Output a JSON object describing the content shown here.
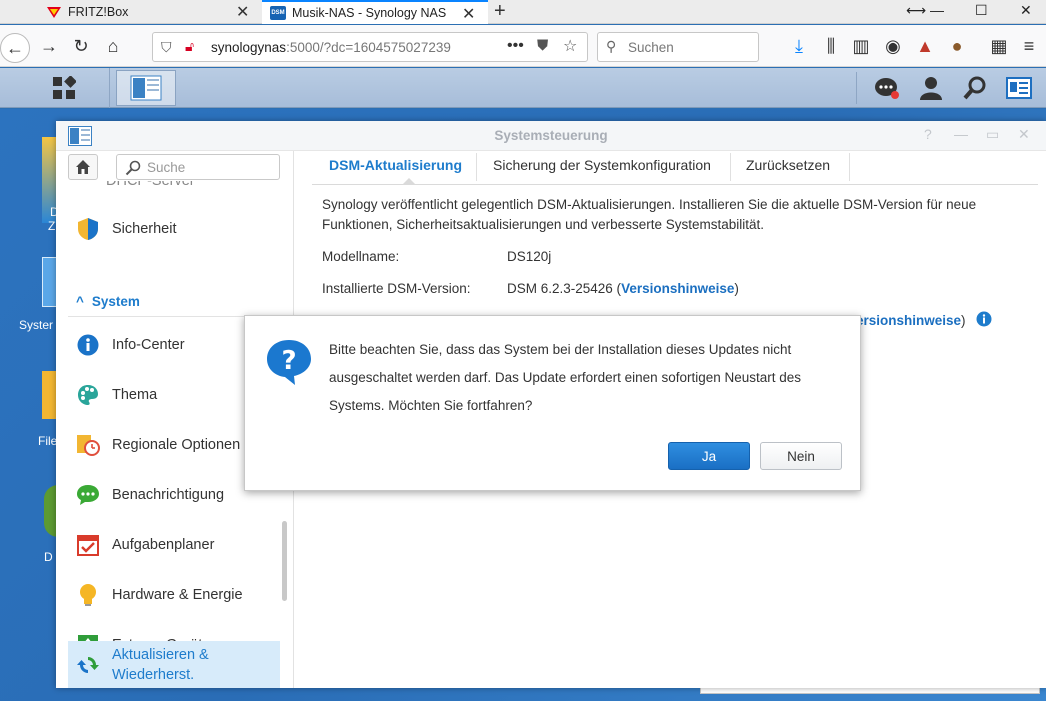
{
  "browser": {
    "tabs": [
      {
        "title": "FRITZ!Box"
      },
      {
        "title": "Musik-NAS - Synology NAS"
      }
    ],
    "url_host": "synologynas",
    "url_rest": ":5000/?dc=1604575027239",
    "search_placeholder": "Suchen"
  },
  "desktop": {
    "labels": [
      "D",
      "Z",
      "Syster",
      "File",
      "D"
    ]
  },
  "window": {
    "title": "Systemsteuerung",
    "sidebar": {
      "search_placeholder": "Suche",
      "partial_item": "DHCP-Server",
      "group": "System",
      "items": [
        {
          "label": "Sicherheit",
          "icon": "shield-icon"
        },
        {
          "label": "Info-Center",
          "icon": "info-icon"
        },
        {
          "label": "Thema",
          "icon": "palette-icon"
        },
        {
          "label": "Regionale Optionen",
          "icon": "regional-clock-icon"
        },
        {
          "label": "Benachrichtigung",
          "icon": "chat-bubble-icon"
        },
        {
          "label": "Aufgabenplaner",
          "icon": "calendar-check-icon"
        },
        {
          "label": "Hardware & Energie",
          "icon": "lightbulb-icon"
        },
        {
          "label": "Externe Geräte",
          "icon": "upload-box-icon"
        },
        {
          "label": "Aktualisieren &",
          "label2": "Wiederherst.",
          "icon": "refresh-icon"
        }
      ]
    },
    "tabs": [
      "DSM-Aktualisierung",
      "Sicherung der Systemkonfiguration",
      "Zurücksetzen"
    ],
    "description": "Synology veröffentlicht gelegentlich DSM-Aktualisierungen. Installieren Sie die aktuelle DSM-Version für neue Funktionen, Sicherheitsaktualisierungen und verbesserte Systemstabilität.",
    "fields": [
      {
        "label": "Modellname:",
        "value": "DS120j"
      },
      {
        "label": "Installierte DSM-Version:",
        "value": "DSM 6.2.3-25426 (",
        "link": "Versionshinweise",
        "suffix": ")"
      }
    ],
    "partial_link": "ersionshinweise",
    "partial_suffix": ")"
  },
  "dialog": {
    "message": "Bitte beachten Sie, dass das System bei der Installation dieses Updates nicht ausgeschaltet werden darf. Das Update erfordert einen sofortigen Neustart des Systems. Möchten Sie fortfahren?",
    "yes_label": "Ja",
    "no_label": "Nein"
  },
  "colors": {
    "accent": "#1e7ccc",
    "desktop": "#2c73bf",
    "active_item_bg": "#d7ebfa"
  }
}
